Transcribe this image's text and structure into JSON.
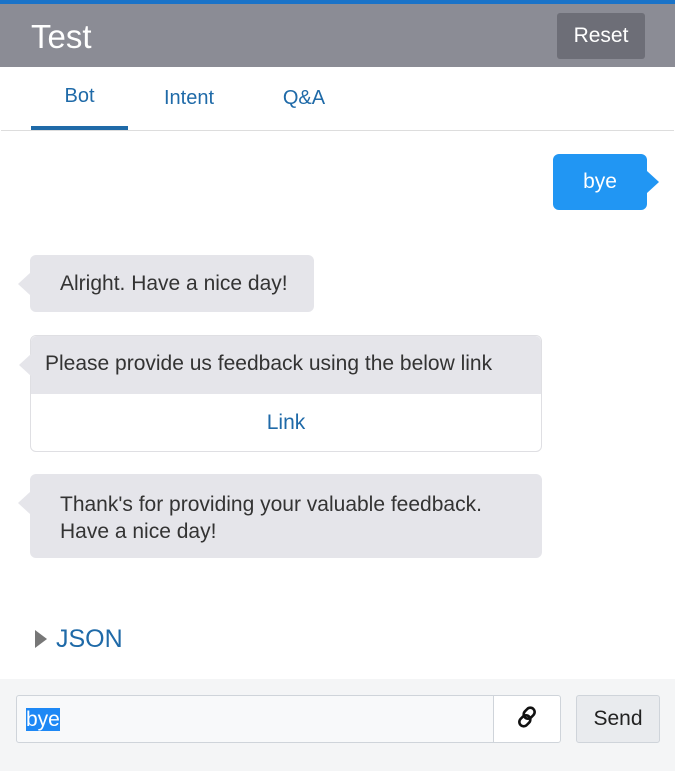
{
  "header": {
    "title": "Test",
    "reset_label": "Reset",
    "accent_color": "#1a73c8",
    "bg_color": "#8b8c95"
  },
  "tabs": [
    {
      "label": "Bot",
      "active": true
    },
    {
      "label": "Intent",
      "active": false
    },
    {
      "label": "Q&A",
      "active": false
    }
  ],
  "messages": {
    "user": "bye",
    "bot1": "Alright. Have a nice day!",
    "feedback_prompt": "Please provide us feedback using the below link",
    "feedback_link": "Link",
    "bot3_line1": "Thank's for providing your valuable feedback.",
    "bot3_line2": "Have a nice day!"
  },
  "json_section": {
    "label": "JSON",
    "expanded": false
  },
  "composer": {
    "input_value": "bye",
    "link_icon": "link-icon",
    "send_label": "Send"
  }
}
